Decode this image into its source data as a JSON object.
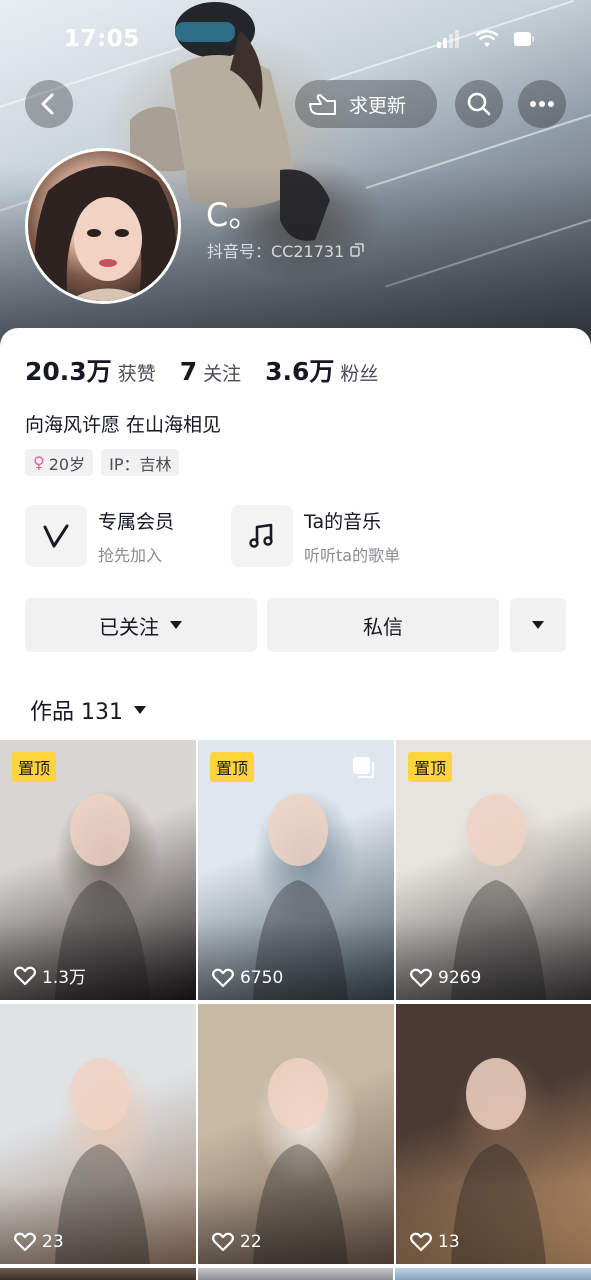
{
  "status_bar": {
    "time": "17:05"
  },
  "header": {
    "update_label": "求更新",
    "nickname": "C。",
    "douyin_id": "抖音号：CC21731"
  },
  "stats": [
    {
      "value": "20.3万",
      "label": "获赞"
    },
    {
      "value": "7",
      "label": "关注"
    },
    {
      "value": "3.6万",
      "label": "粉丝"
    }
  ],
  "bio": "向海风许愿 在山海相见",
  "tags": {
    "age": "20岁",
    "ip": "IP：吉林"
  },
  "features": [
    {
      "title": "专属会员",
      "subtitle": "抢先加入",
      "icon": "vip-v-icon"
    },
    {
      "title": "Ta的音乐",
      "subtitle": "听听ta的歌单",
      "icon": "music-note-icon"
    }
  ],
  "actions": {
    "following": "已关注",
    "message": "私信"
  },
  "works": {
    "label": "作品 131"
  },
  "grid": [
    {
      "pinned": "置顶",
      "likes": "1.3万",
      "colors": [
        "#d9d5d2",
        "#6f6660",
        "#1f1a1c"
      ]
    },
    {
      "pinned": "置顶",
      "likes": "6750",
      "colors": [
        "#dfe7ee",
        "#7b8e9c",
        "#3c4a55"
      ]
    },
    {
      "pinned": "置顶",
      "likes": "9269",
      "colors": [
        "#e7e4df",
        "#cfc7bd",
        "#3d3a3b"
      ]
    },
    {
      "pinned": "",
      "likes": "23",
      "colors": [
        "#dfe3e6",
        "#e8c9b6",
        "#9b7e69"
      ]
    },
    {
      "pinned": "",
      "likes": "22",
      "colors": [
        "#c7b9a4",
        "#efe9e2",
        "#6d5a4d"
      ]
    },
    {
      "pinned": "",
      "likes": "13",
      "colors": [
        "#4a3a33",
        "#7b5e4c",
        "#d9a877"
      ]
    }
  ],
  "colors": {
    "pin": "#fdd33e",
    "accent_female": "#f05a9c",
    "button_bg": "#f1f1f2"
  }
}
